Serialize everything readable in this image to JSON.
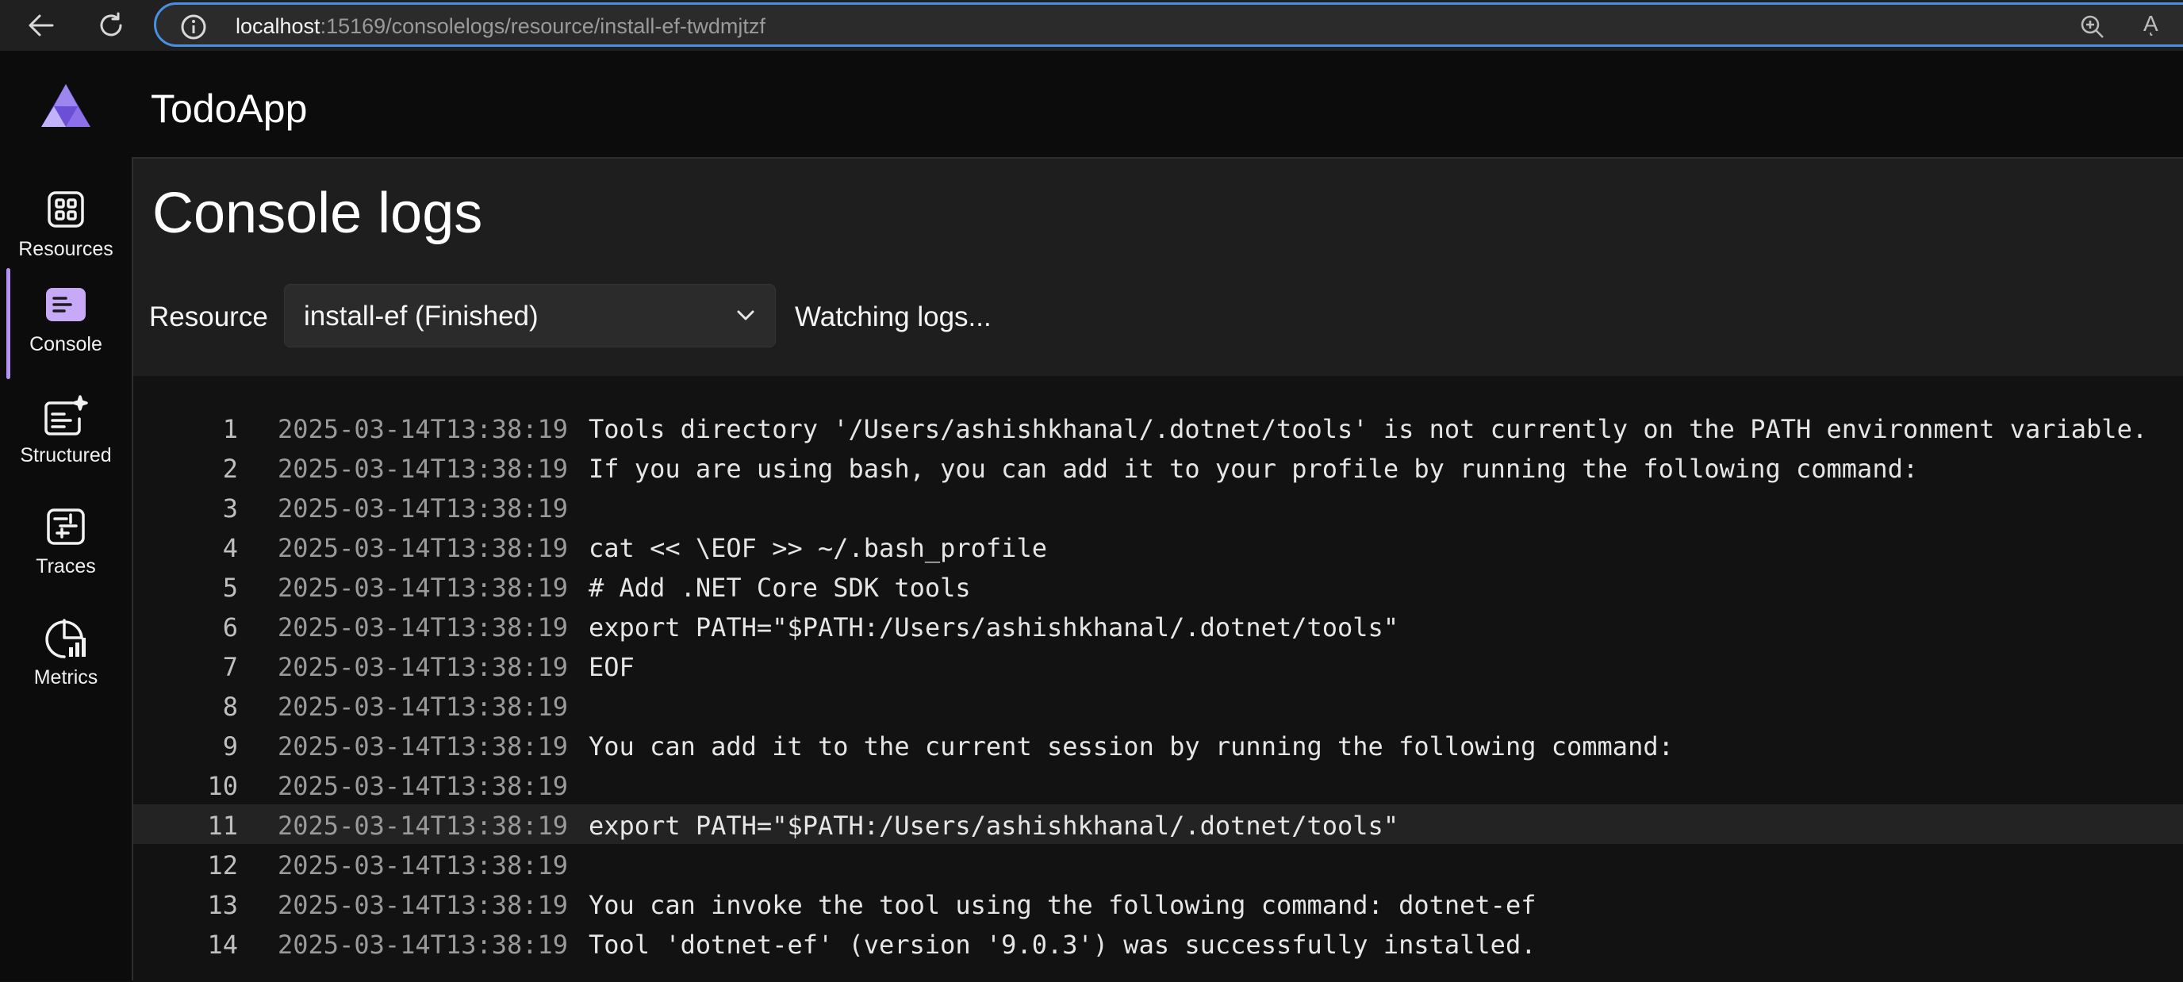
{
  "browser": {
    "url_host": "localhost",
    "url_rest": ":15169/consolelogs/resource/install-ef-twdmjtzf",
    "read_aloud_icon": "Aͅ"
  },
  "app": {
    "title": "TodoApp"
  },
  "sidebar": {
    "items": [
      {
        "label": "Resources",
        "icon": "grid-icon"
      },
      {
        "label": "Console",
        "icon": "console-icon",
        "active": true
      },
      {
        "label": "Structured",
        "icon": "structured-icon"
      },
      {
        "label": "Traces",
        "icon": "traces-icon"
      },
      {
        "label": "Metrics",
        "icon": "metrics-icon"
      }
    ]
  },
  "main": {
    "title": "Console logs",
    "resource_label": "Resource",
    "resource_value": "install-ef (Finished)",
    "status": "Watching logs..."
  },
  "logs": [
    {
      "n": "1",
      "ts": "2025-03-14T13:38:19",
      "msg": "Tools directory '/Users/ashishkhanal/.dotnet/tools' is not currently on the PATH environment variable."
    },
    {
      "n": "2",
      "ts": "2025-03-14T13:38:19",
      "msg": "If you are using bash, you can add it to your profile by running the following command:"
    },
    {
      "n": "3",
      "ts": "2025-03-14T13:38:19",
      "msg": ""
    },
    {
      "n": "4",
      "ts": "2025-03-14T13:38:19",
      "msg": "cat << \\EOF >> ~/.bash_profile"
    },
    {
      "n": "5",
      "ts": "2025-03-14T13:38:19",
      "msg": "# Add .NET Core SDK tools"
    },
    {
      "n": "6",
      "ts": "2025-03-14T13:38:19",
      "msg": "export PATH=\"$PATH:/Users/ashishkhanal/.dotnet/tools\""
    },
    {
      "n": "7",
      "ts": "2025-03-14T13:38:19",
      "msg": "EOF"
    },
    {
      "n": "8",
      "ts": "2025-03-14T13:38:19",
      "msg": ""
    },
    {
      "n": "9",
      "ts": "2025-03-14T13:38:19",
      "msg": "You can add it to the current session by running the following command:"
    },
    {
      "n": "10",
      "ts": "2025-03-14T13:38:19",
      "msg": ""
    },
    {
      "n": "11",
      "ts": "2025-03-14T13:38:19",
      "msg": "export PATH=\"$PATH:/Users/ashishkhanal/.dotnet/tools\"",
      "highlighted": true
    },
    {
      "n": "12",
      "ts": "2025-03-14T13:38:19",
      "msg": ""
    },
    {
      "n": "13",
      "ts": "2025-03-14T13:38:19",
      "msg": "You can invoke the tool using the following command: dotnet-ef"
    },
    {
      "n": "14",
      "ts": "2025-03-14T13:38:19",
      "msg": "Tool 'dotnet-ef' (version '9.0.3') was successfully installed."
    }
  ]
}
